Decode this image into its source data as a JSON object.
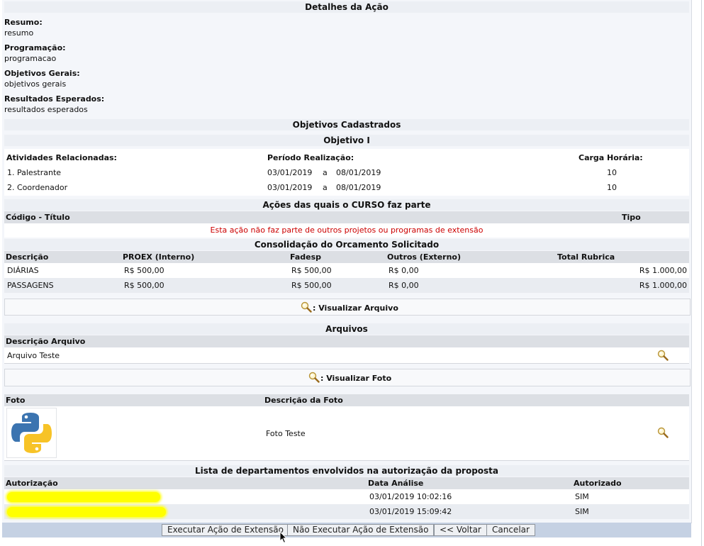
{
  "detalhes": {
    "title": "Detalhes da Ação",
    "resumo_label": "Resumo:",
    "resumo_value": "resumo",
    "programacao_label": "Programação:",
    "programacao_value": "programacao",
    "objetivos_label": "Objetivos Gerais:",
    "objetivos_value": "objetivos gerais",
    "resultados_label": "Resultados Esperados:",
    "resultados_value": "resultados esperados"
  },
  "objetivos": {
    "title": "Objetivos Cadastrados",
    "subtitle": "Objetivo I",
    "headers": {
      "atividades": "Atividades Relacionadas:",
      "periodo": "Período Realização:",
      "carga": "Carga Horária:"
    },
    "rows": [
      {
        "atividade": "1. Palestrante",
        "inicio": "03/01/2019",
        "sep": "a",
        "fim": "08/01/2019",
        "carga": "10"
      },
      {
        "atividade": "2. Coordenador",
        "inicio": "03/01/2019",
        "sep": "a",
        "fim": "08/01/2019",
        "carga": "10"
      }
    ]
  },
  "acoes": {
    "title": "Ações das quais o CURSO faz parte",
    "col_codigo": "Código - Título",
    "col_tipo": "Tipo",
    "empty_message": "Esta ação não faz parte de outros projetos ou programas de extensão"
  },
  "orcamento": {
    "title": "Consolidação do Orcamento Solicitado",
    "headers": {
      "descricao": "Descrição",
      "proex": "PROEX (Interno)",
      "fadesp": "Fadesp",
      "outros": "Outros (Externo)",
      "total": "Total Rubrica"
    },
    "rows": [
      {
        "descricao": "DIÁRIAS",
        "proex": "R$ 500,00",
        "fadesp": "R$ 500,00",
        "outros": "R$ 0,00",
        "total": "R$ 1.000,00"
      },
      {
        "descricao": "PASSAGENS",
        "proex": "R$ 500,00",
        "fadesp": "R$ 500,00",
        "outros": "R$ 0,00",
        "total": "R$ 1.000,00"
      }
    ]
  },
  "arquivos": {
    "legend": ": Visualizar Arquivo",
    "title": "Arquivos",
    "col_descricao": "Descrição Arquivo",
    "rows": [
      {
        "descricao": "Arquivo Teste",
        "icon": "magnifier-icon"
      }
    ]
  },
  "fotos": {
    "legend": ": Visualizar Foto",
    "col_foto": "Foto",
    "col_descricao": "Descrição da Foto",
    "rows": [
      {
        "thumb": "python-logo",
        "descricao": "Foto Teste",
        "icon": "magnifier-icon"
      }
    ]
  },
  "departamentos": {
    "title": "Lista de departamentos envolvidos na autorização da proposta",
    "headers": {
      "autorizacao": "Autorização",
      "data": "Data Análise",
      "autorizado": "Autorizado"
    },
    "rows": [
      {
        "autorizacao": "",
        "data": "03/01/2019 10:02:16",
        "autorizado": "SIM"
      },
      {
        "autorizacao": "",
        "data": "03/01/2019 15:09:42",
        "autorizado": "SIM"
      }
    ]
  },
  "buttons": {
    "executar": "Executar Ação de Extensão",
    "nao_executar": "Não Executar Ação de Extensão",
    "voltar": "<< Voltar",
    "cancelar": "Cancelar"
  },
  "colors": {
    "highlight": "#ffff00",
    "error": "#cc0000",
    "footer": "#c5d1e3"
  }
}
